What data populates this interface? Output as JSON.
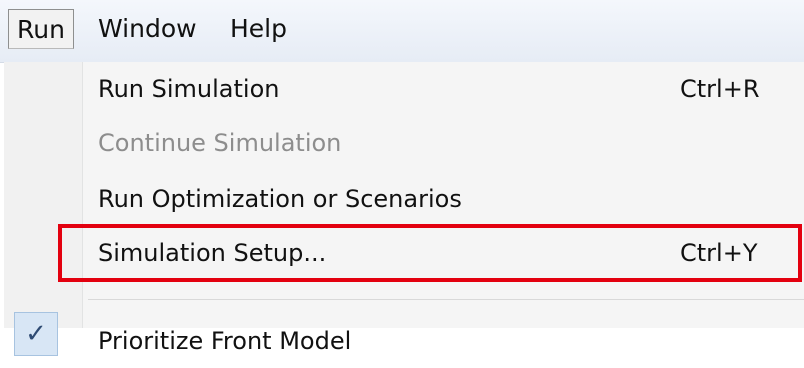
{
  "menubar": {
    "items": [
      {
        "label": "Run",
        "active": true
      },
      {
        "label": "Window",
        "active": false
      },
      {
        "label": "Help",
        "active": false
      }
    ]
  },
  "dropdown": {
    "items": [
      {
        "label": "Run Simulation",
        "shortcut": "Ctrl+R",
        "enabled": true
      },
      {
        "label": "Continue Simulation",
        "shortcut": "",
        "enabled": false
      },
      {
        "label": "Run Optimization or Scenarios",
        "shortcut": "",
        "enabled": true
      },
      {
        "label": "Simulation Setup...",
        "shortcut": "Ctrl+Y",
        "enabled": true,
        "highlighted": true
      },
      {
        "label": "Prioritize Front Model",
        "shortcut": "",
        "enabled": true,
        "checked": true
      }
    ],
    "check_glyph": "✓"
  },
  "colors": {
    "highlight_border": "#e3000f",
    "menubar_bg": "#e6ecf5",
    "disabled_text": "#8d8d8d"
  }
}
